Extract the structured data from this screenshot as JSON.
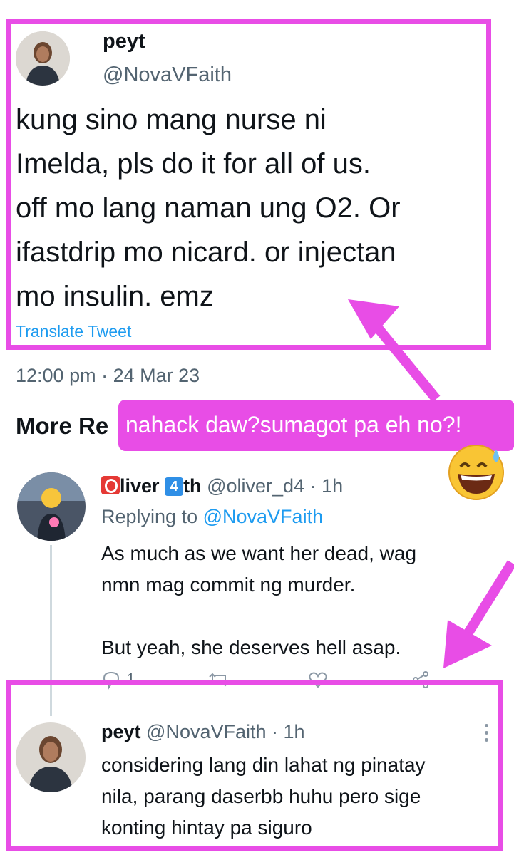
{
  "main_tweet": {
    "name": "peyt",
    "handle": "@NovaVFaith",
    "lines": [
      "kung sino mang nurse ni",
      "Imelda, pls do it for all of us.",
      "off mo lang naman ung O2. Or",
      "ifastdrip mo nicard. or injectan",
      "mo insulin. emz"
    ],
    "translate": "Translate Tweet",
    "timestamp": "12:00 pm · 24 Mar 23"
  },
  "section": {
    "title": "More Re"
  },
  "annotation": {
    "text": "nahack daw?sumagot pa eh no?!",
    "emoji_icon": "grinning-sweat-face"
  },
  "reply1": {
    "name_prefix_icon": "red-o-square",
    "name_part1": "liver",
    "badge_icon": "keycap-4",
    "name_part2": "th",
    "handle": "@oliver_d4",
    "time": "· 1h",
    "replying_label": "Replying to",
    "replying_handle": "@NovaVFaith",
    "lines": [
      "As much as we want her dead, wag",
      "nmn mag commit ng murder.",
      "",
      "But yeah, she deserves hell asap."
    ],
    "reply_count": "1"
  },
  "reply2": {
    "name": "peyt",
    "handle": "@NovaVFaith",
    "time": "· 1h",
    "lines": [
      "considering lang din lahat ng pinatay",
      "nila, parang daserbb huhu pero sige",
      "konting hintay pa siguro"
    ]
  },
  "colors": {
    "highlight": "#e84de6",
    "link": "#1d9bf0",
    "muted": "#536471",
    "text": "#0f1419"
  }
}
